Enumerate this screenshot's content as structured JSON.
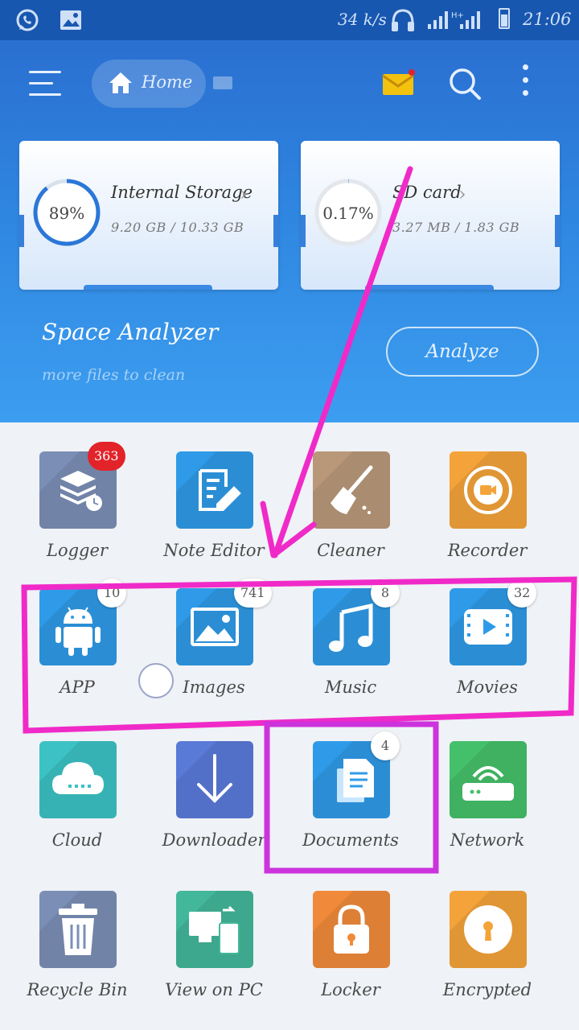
{
  "status_bar": {
    "speed": "34 k/s",
    "time": "21:06"
  },
  "toolbar": {
    "home_label": "Home"
  },
  "storage": [
    {
      "title": "Internal Storage",
      "usage": "9.20 GB / 10.33 GB",
      "percent_text": "89%",
      "percent": 89
    },
    {
      "title": "SD card",
      "usage": "3.27 MB / 1.83 GB",
      "percent_text": "0.17%",
      "percent": 0.17
    }
  ],
  "space_analyzer": {
    "title": "Space Analyzer",
    "subtitle": "more files to clean",
    "button": "Analyze"
  },
  "grid": [
    {
      "label": "Logger",
      "badge": "363",
      "color": "#7b8fb6",
      "icon": "logger-icon"
    },
    {
      "label": "Note Editor",
      "badge": "",
      "color": "#2f9be8",
      "icon": "note-editor-icon"
    },
    {
      "label": "Cleaner",
      "badge": "",
      "color": "#b9987a",
      "icon": "broom-icon"
    },
    {
      "label": "Recorder",
      "badge": "",
      "color": "#f4a33a",
      "icon": "recorder-icon"
    },
    {
      "label": "APP",
      "badge": "10",
      "color": "#2f9be8",
      "icon": "android-icon"
    },
    {
      "label": "Images",
      "badge": "741",
      "color": "#2f9be8",
      "icon": "image-icon"
    },
    {
      "label": "Music",
      "badge": "8",
      "color": "#2f9be8",
      "icon": "music-icon"
    },
    {
      "label": "Movies",
      "badge": "32",
      "color": "#2f9be8",
      "icon": "movie-icon"
    },
    {
      "label": "Cloud",
      "badge": "",
      "color": "#3cc2c4",
      "icon": "cloud-icon"
    },
    {
      "label": "Downloader",
      "badge": "",
      "color": "#5a7ad8",
      "icon": "download-icon"
    },
    {
      "label": "Documents",
      "badge": "4",
      "color": "#2f9be8",
      "icon": "document-icon"
    },
    {
      "label": "Network",
      "badge": "",
      "color": "#45c06a",
      "icon": "network-icon"
    },
    {
      "label": "Recycle Bin",
      "badge": "",
      "color": "#7b8fb6",
      "icon": "trash-icon"
    },
    {
      "label": "View on PC",
      "badge": "",
      "color": "#43b79a",
      "icon": "pc-icon"
    },
    {
      "label": "Locker",
      "badge": "",
      "color": "#f08a3a",
      "icon": "lock-icon"
    },
    {
      "label": "Encrypted",
      "badge": "",
      "color": "#f4a33a",
      "icon": "encrypted-icon"
    }
  ],
  "annotation_colors": {
    "arrow": "#f02ac8",
    "box1": "#f02ac8",
    "box2": "#cc33dd"
  }
}
